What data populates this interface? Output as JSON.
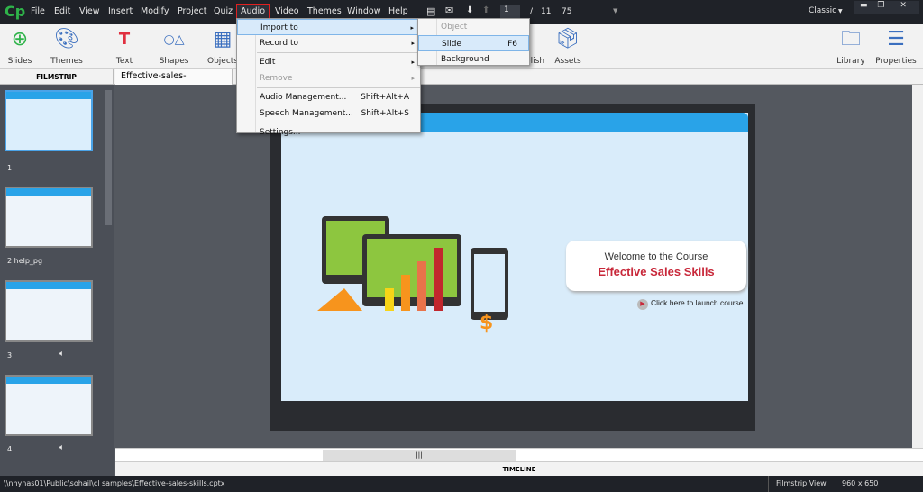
{
  "app": {
    "logo": "Cp"
  },
  "menubar": {
    "items": [
      "File",
      "Edit",
      "View",
      "Insert",
      "Modify",
      "Project",
      "Quiz",
      "Audio",
      "Video",
      "Themes",
      "Window",
      "Help"
    ],
    "page_current": "1",
    "page_sep": "/",
    "page_total": "11",
    "zoom": "75",
    "mode": "Classic"
  },
  "toolbar": {
    "slides": "Slides",
    "themes": "Themes",
    "text": "Text",
    "shapes": "Shapes",
    "objects": "Objects",
    "publish": "Publish",
    "assets": "Assets",
    "library": "Library",
    "properties": "Properties"
  },
  "filmstrip": {
    "header": "FILMSTRIP",
    "slides": [
      {
        "label": "1"
      },
      {
        "label": "2 help_pg"
      },
      {
        "label": "3"
      },
      {
        "label": "4"
      }
    ]
  },
  "document_tab": {
    "title": "Effective-sales-skills.cptx*",
    "close": "×"
  },
  "slide": {
    "welcome": "Welcome to the Course",
    "course_title": "Effective Sales Skills",
    "launch": "Click here to launch course."
  },
  "audio_menu": {
    "items": [
      {
        "label": "Import to",
        "arrow": "▸"
      },
      {
        "label": "Record to",
        "arrow": "▸"
      },
      {
        "label": "Edit",
        "arrow": "▸"
      },
      {
        "label": "Remove",
        "arrow": "▸"
      },
      {
        "label": "Audio Management...",
        "shortcut": "Shift+Alt+A"
      },
      {
        "label": "Speech Management...",
        "shortcut": "Shift+Alt+S"
      },
      {
        "label": "Settings..."
      }
    ]
  },
  "import_submenu": {
    "items": [
      {
        "label": "Object"
      },
      {
        "label": "Slide",
        "shortcut": "F6"
      },
      {
        "label": "Background"
      }
    ]
  },
  "timeline": {
    "label": "TIMELINE"
  },
  "statusbar": {
    "path": "\\\\nhynas01\\Public\\sohail\\cl samples\\Effective-sales-skills.cptx",
    "view": "Filmstrip View",
    "size": "960 x 650"
  },
  "colors": {
    "accent": "#29a3e8",
    "title_red": "#c8283a",
    "menu_highlight": "#e02020"
  }
}
